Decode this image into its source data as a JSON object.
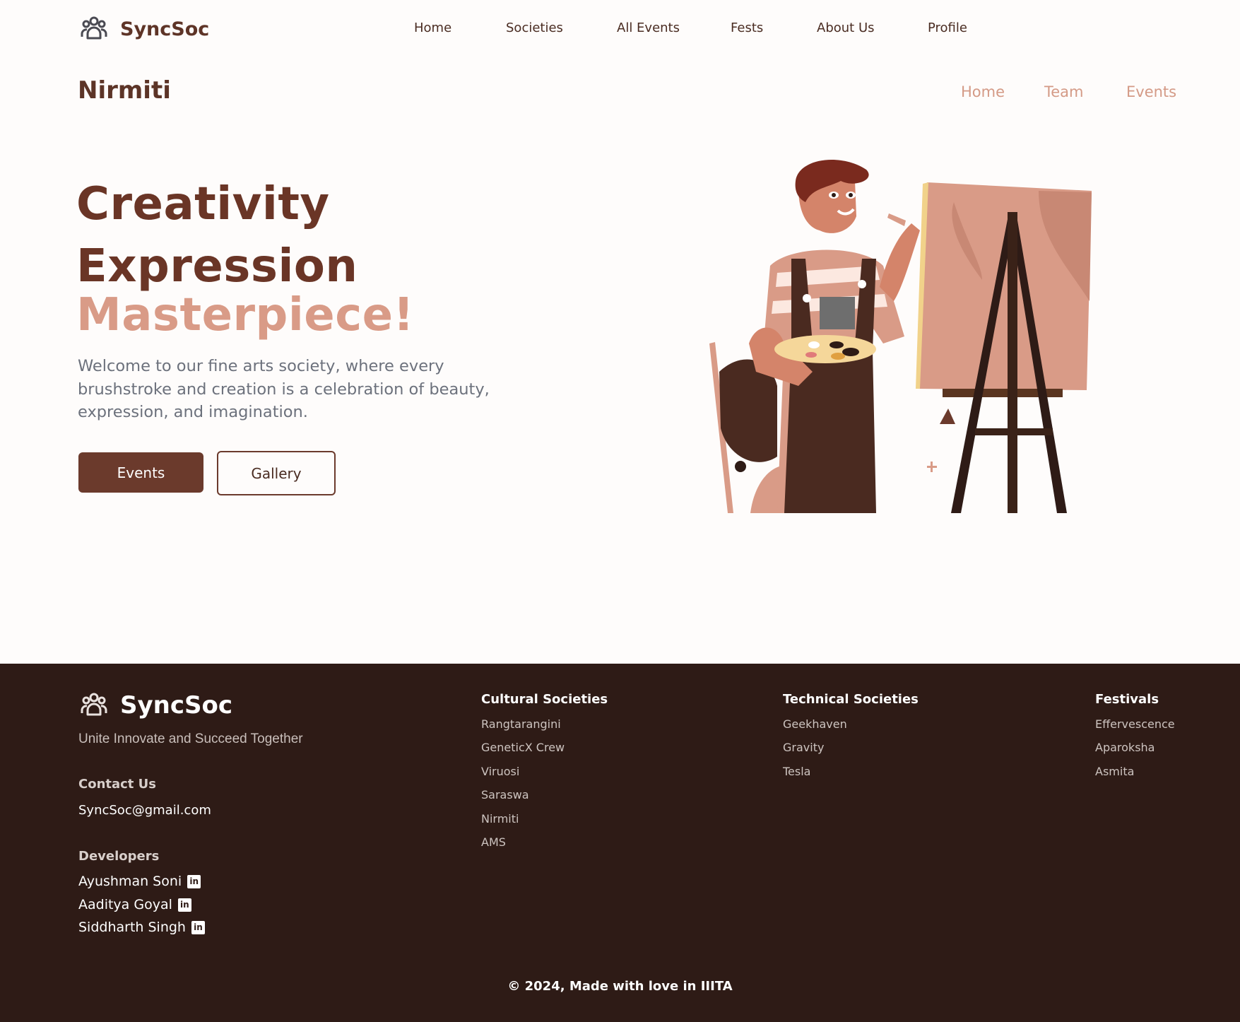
{
  "header": {
    "brand": "SyncSoc",
    "logo_icon": "users-group-icon",
    "nav": [
      "Home",
      "Societies",
      "All Events",
      "Fests",
      "About Us",
      "Profile"
    ]
  },
  "society": {
    "title": "Nirmiti",
    "subnav": [
      "Home",
      "Team",
      "Events"
    ]
  },
  "hero": {
    "line1": "Creativity",
    "line2": "Expression",
    "line3": "Masterpiece!",
    "description": "Welcome to our fine arts society, where every brushstroke and creation is a celebration of beauty, expression, and imagination.",
    "primary_button": "Events",
    "secondary_button": "Gallery",
    "illustration_icon": "painter-at-easel-illustration"
  },
  "footer": {
    "brand": "SyncSoc",
    "tagline": "Unite Innovate and Succeed Together",
    "contact_label": "Contact Us",
    "contact_email": "SyncSoc@gmail.com",
    "developers_label": "Developers",
    "developers": [
      "Ayushman Soni",
      "Aaditya Goyal",
      "Siddharth Singh"
    ],
    "linkedin_icon": "linkedin-icon",
    "columns": [
      {
        "title": "Cultural Societies",
        "items": [
          "Rangtarangini",
          "GeneticX Crew",
          "Viruosi",
          "Saraswa",
          "Nirmiti",
          "AMS"
        ]
      },
      {
        "title": "Technical Societies",
        "items": [
          "Geekhaven",
          "Gravity",
          "Tesla"
        ]
      },
      {
        "title": "Festivals",
        "items": [
          "Effervescence",
          "Aparoksha",
          "Asmita"
        ]
      }
    ],
    "copyright": "© 2024, Made with love in IIITA"
  },
  "colors": {
    "brand_brown": "#6b3a2c",
    "accent_pink": "#d99b87",
    "footer_bg": "#2e1b16"
  }
}
